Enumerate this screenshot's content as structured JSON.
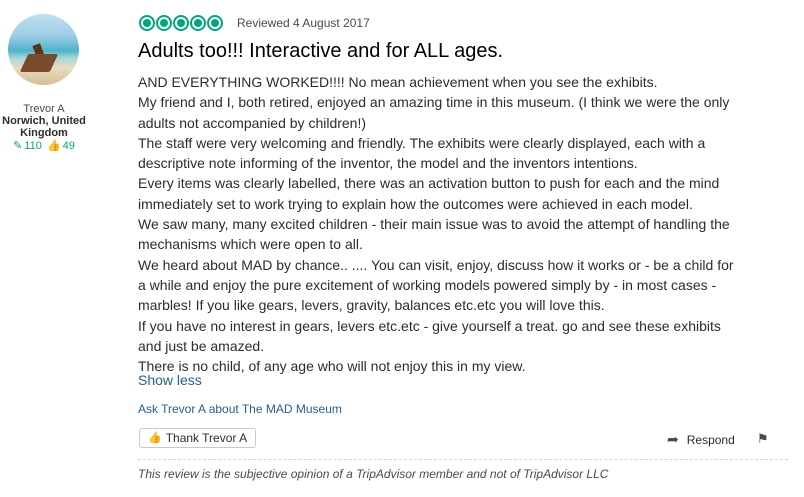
{
  "reviewer": {
    "name": "Trevor A",
    "location": "Norwich, United Kingdom",
    "reviews_count": "110",
    "helpful_votes": "49"
  },
  "review": {
    "rating": 5,
    "reviewed_date": "Reviewed 4 August 2017",
    "title": "Adults too!!! Interactive and for ALL ages.",
    "paragraphs": [
      "AND EVERYTHING WORKED!!!! No mean achievement when you see the exhibits.",
      "My friend and I, both retired, enjoyed an amazing time in this museum. (I think we were the only adults not accompanied by children!)",
      "The staff were very welcoming and friendly. The exhibits were clearly displayed, each with a descriptive note informing of the inventor, the model and the inventors intentions.",
      "Every items was clearly labelled, there was an activation button to push for each and the mind immediately set to work trying to explain how the outcomes were achieved in each model.",
      "We saw many, many excited children - their main issue was to avoid the attempt of handling the mechanisms which were open to all.",
      "We heard about MAD by chance.. .... You can visit, enjoy, discuss how it works or - be a child for a while and enjoy the pure excitement of working models powered simply by - in most cases - marbles! If you like gears, levers, gravity, balances etc.etc you will love this.",
      "If you have no interest in gears, levers etc.etc - give yourself a treat. go and see these exhibits and just be amazed.",
      "There is no child, of any age who will not enjoy this in my view."
    ],
    "show_less": "Show less",
    "ask_link": "Ask Trevor A about The MAD Museum",
    "thank_button": "Thank Trevor A",
    "respond_button": "Respond",
    "disclaimer": "This review is the subjective opinion of a TripAdvisor member and not of TripAdvisor LLC"
  },
  "icons": {
    "reviews": "pencil-icon",
    "votes": "thumbs-up-icon",
    "thank": "thumbs-up-icon",
    "respond": "reply-arrow-icon",
    "report": "flag-icon"
  },
  "colors": {
    "accent": "#00a680",
    "link": "#2b5d8a",
    "text": "#2c2c2c"
  }
}
